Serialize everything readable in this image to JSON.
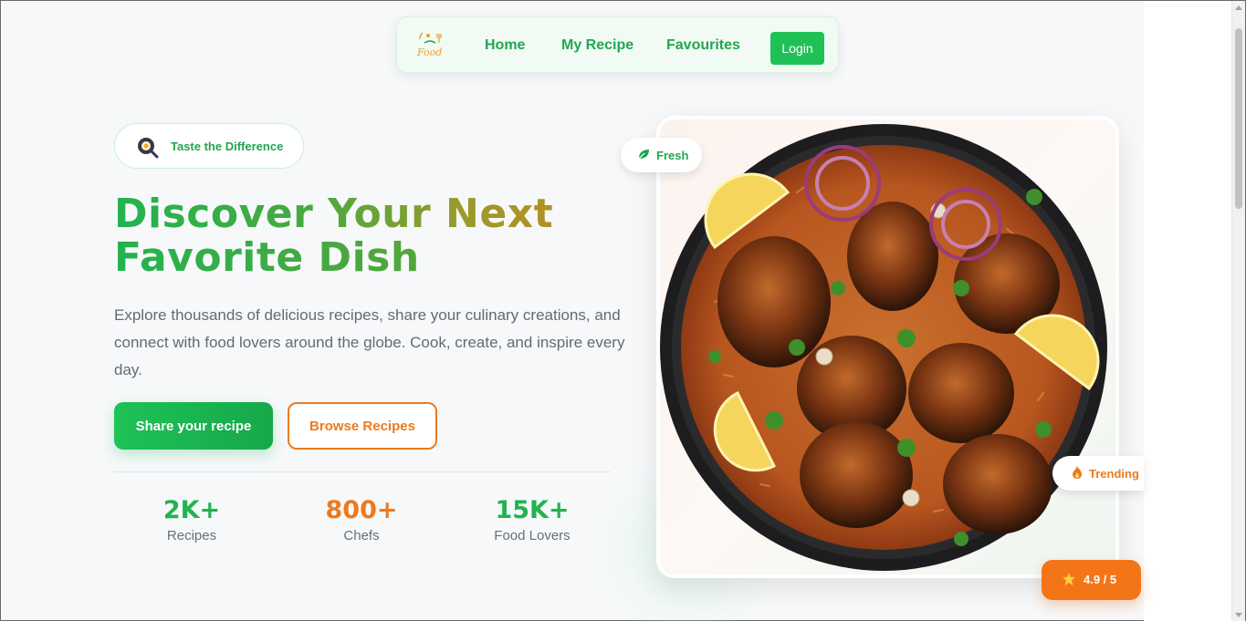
{
  "nav": {
    "logo_text": "Food",
    "items": [
      {
        "label": "Home"
      },
      {
        "label": "My Recipe"
      },
      {
        "label": "Favourites"
      }
    ],
    "login_label": "Login"
  },
  "hero": {
    "badge_text": "Taste the Difference",
    "headline_line1": "Discover Your Next",
    "headline_line2": "Favorite Dish",
    "description": "Explore thousands of delicious recipes, share your culinary creations, and connect with food lovers around the globe. Cook, create, and inspire every day.",
    "primary_button": "Share your recipe",
    "secondary_button": "Browse Recipes",
    "stats": [
      {
        "value": "2K+",
        "label": "Recipes",
        "color": "#22b34e"
      },
      {
        "value": "800+",
        "label": "Chefs",
        "color": "#ec7a1d"
      },
      {
        "value": "15K+",
        "label": "Food Lovers",
        "color": "#22b34e"
      }
    ]
  },
  "image_card": {
    "fresh_label": "Fresh",
    "trending_label": "Trending",
    "rating_text": "4.9 / 5"
  },
  "colors": {
    "brand_green": "#1fc157",
    "brand_orange": "#ec7a1d",
    "text_muted": "#666a70"
  },
  "icons": {
    "logo": "food-logo-icon",
    "badge": "frying-pan-icon",
    "fresh": "leaf-icon",
    "trending": "flame-icon",
    "rating": "star-icon"
  }
}
